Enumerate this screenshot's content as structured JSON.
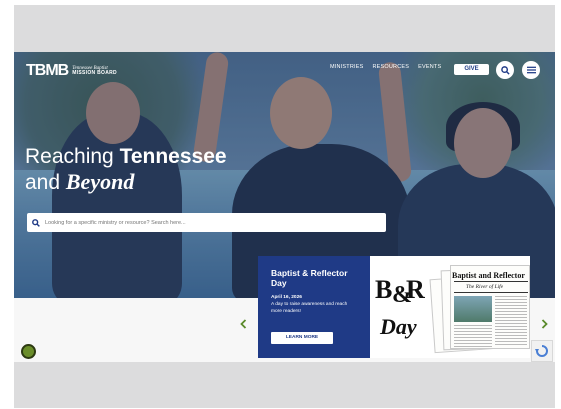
{
  "header": {
    "logo_mark": "TBMB",
    "logo_line1": "Tennessee Baptist",
    "logo_line2": "MISSION BOARD",
    "nav": [
      "MINISTRIES",
      "RESOURCES",
      "EVENTS"
    ],
    "give_label": "GIVE"
  },
  "hero": {
    "headline_part1": "Reaching ",
    "headline_part2": "Tennessee",
    "headline_part3": "and ",
    "headline_part4": "Beyond"
  },
  "search": {
    "placeholder": "Looking for a specific ministry or resource? Search here..."
  },
  "carousel": {
    "card": {
      "title": "Baptist & Reflector Day",
      "date": "April 16, 2026",
      "description": "A day to raise awareness and reach more readers!",
      "button_label": "LEARN MORE"
    },
    "newspaper": {
      "logo_text": "B&R Day",
      "masthead": "Baptist and Reflector",
      "subhead": "The River of Life"
    }
  },
  "colors": {
    "brand_blue": "#1f3a86",
    "accent_green": "#5a8a2a",
    "gray_frame": "#dcdcdd"
  }
}
